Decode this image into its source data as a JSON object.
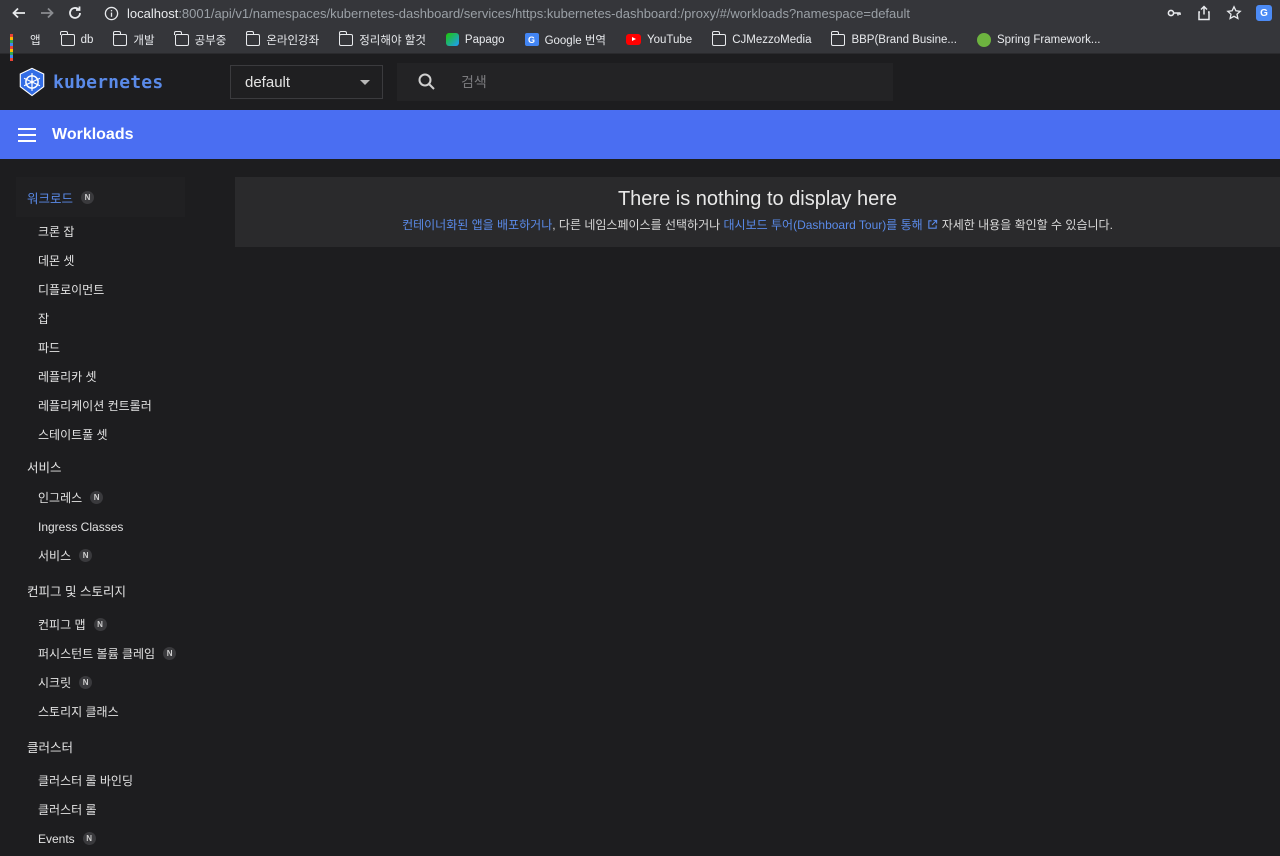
{
  "browser": {
    "url_host": "localhost",
    "url_rest": ":8001/api/v1/namespaces/kubernetes-dashboard/services/https:kubernetes-dashboard:/proxy/#/workloads?namespace=default",
    "bookmarks": [
      {
        "label": "앱",
        "icon": "apps-grid-icon"
      },
      {
        "label": "db",
        "icon": "folder-icon"
      },
      {
        "label": "개발",
        "icon": "folder-icon"
      },
      {
        "label": "공부중",
        "icon": "folder-icon"
      },
      {
        "label": "온라인강좌",
        "icon": "folder-icon"
      },
      {
        "label": "정리해야 할것",
        "icon": "folder-icon"
      },
      {
        "label": "Papago",
        "icon": "papago-icon"
      },
      {
        "label": "Google 번역",
        "icon": "google-translate-icon"
      },
      {
        "label": "YouTube",
        "icon": "youtube-icon"
      },
      {
        "label": "CJMezzoMedia",
        "icon": "folder-icon"
      },
      {
        "label": "BBP(Brand Busine...",
        "icon": "folder-icon"
      },
      {
        "label": "Spring Framework...",
        "icon": "spring-icon"
      }
    ]
  },
  "header": {
    "logo_text": "kubernetes",
    "namespace": "default",
    "search_placeholder": "검색"
  },
  "toolbar": {
    "title": "Workloads"
  },
  "sidebar": {
    "workloads": {
      "label": "워크로드",
      "badge": "N"
    },
    "workload_items": [
      "크론 잡",
      "데몬 셋",
      "디플로이먼트",
      "잡",
      "파드",
      "레플리카 셋",
      "레플리케이션 컨트롤러",
      "스테이트풀 셋"
    ],
    "service": {
      "label": "서비스"
    },
    "service_items": [
      {
        "label": "인그레스",
        "badge": "N"
      },
      {
        "label": "Ingress Classes",
        "badge": ""
      },
      {
        "label": "서비스",
        "badge": "N"
      }
    ],
    "config": {
      "label": "컨피그 및 스토리지"
    },
    "config_items": [
      {
        "label": "컨피그 맵",
        "badge": "N"
      },
      {
        "label": "퍼시스턴트 볼륨 클레임",
        "badge": "N"
      },
      {
        "label": "시크릿",
        "badge": "N"
      },
      {
        "label": "스토리지 클래스",
        "badge": ""
      }
    ],
    "cluster": {
      "label": "클러스터"
    },
    "cluster_items": [
      {
        "label": "클러스터 롤 바인딩",
        "badge": ""
      },
      {
        "label": "클러스터 롤",
        "badge": ""
      },
      {
        "label": "Events",
        "badge": "N"
      }
    ]
  },
  "content": {
    "empty_title": "There is nothing to display here",
    "link_deploy": "컨테이너화된 앱을 배포하거나",
    "text_middle": ", 다른 네임스페이스를 선택하거나 ",
    "link_tour": "대시보드 투어(Dashboard Tour)를 통해",
    "text_end": "자세한 내용을 확인할 수 있습니다."
  },
  "colors": {
    "accent": "#4a6ef2",
    "link": "#5a8ae8",
    "background": "#1d1d1f"
  }
}
